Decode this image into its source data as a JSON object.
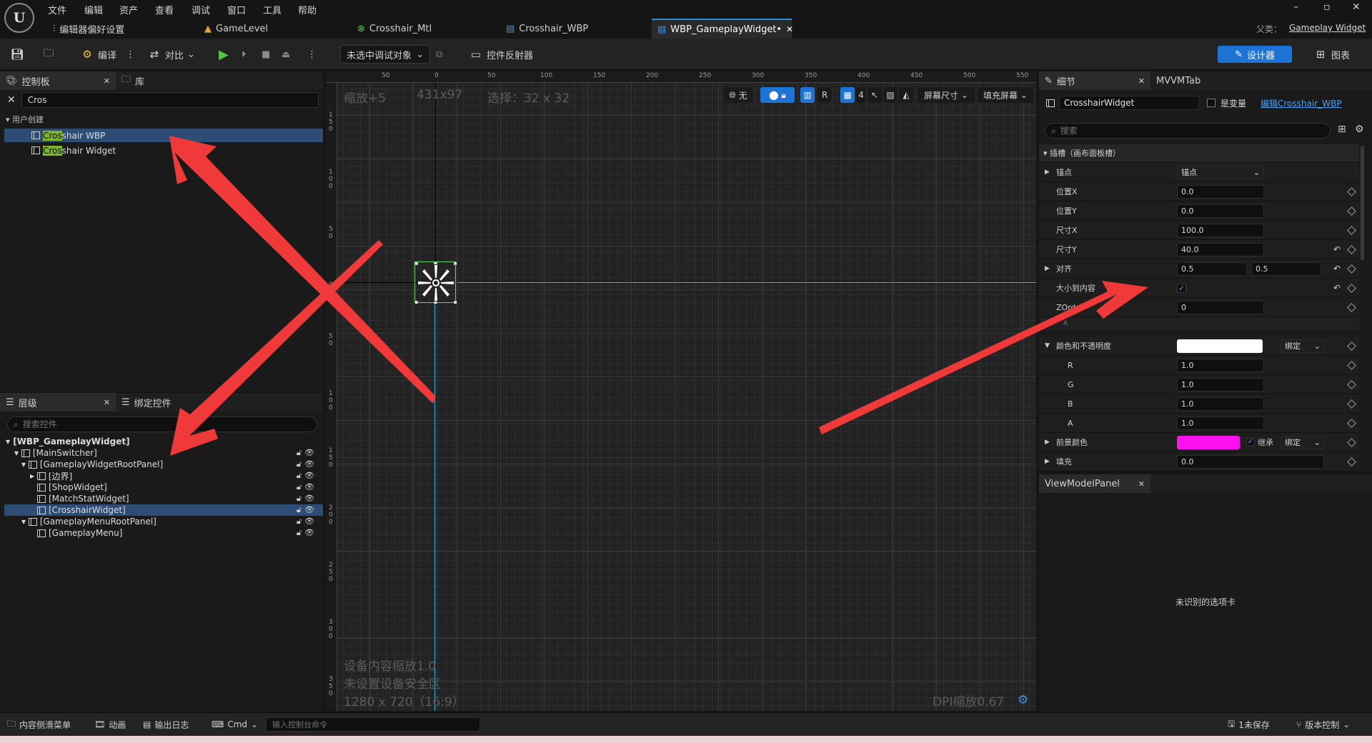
{
  "menu": [
    "文件",
    "编辑",
    "资产",
    "查看",
    "调试",
    "窗口",
    "工具",
    "帮助"
  ],
  "window_controls": [
    "–",
    "▫",
    "✕"
  ],
  "tabs": [
    {
      "label": "编辑器偏好设置",
      "icon": "sliders-icon"
    },
    {
      "label": "GameLevel",
      "icon": "level-icon"
    },
    {
      "label": "Crosshair_Mtl",
      "icon": "material-icon"
    },
    {
      "label": "Crosshair_WBP",
      "icon": "widget-blueprint-icon"
    },
    {
      "label": "WBP_GameplayWidget•",
      "icon": "widget-blueprint-icon",
      "active": true
    }
  ],
  "parent_class": {
    "label": "父类：",
    "value": "Gameplay Widget"
  },
  "toolbar": {
    "compile": "编译",
    "diff": "对比",
    "debug_target": "未选中调试对象",
    "widget_reflector": "控件反射器",
    "designer": "设计器",
    "graph": "图表"
  },
  "palette": {
    "tab": "控制板",
    "library_tab": "库",
    "search_value": "Cros",
    "category": "用户创建",
    "items": [
      {
        "match": "Cros",
        "rest": "shair WBP"
      },
      {
        "match": "Cros",
        "rest": "shair Widget"
      }
    ]
  },
  "hierarchy": {
    "tab": "层级",
    "bind_tab": "绑定控件",
    "search_placeholder": "搜索控件",
    "rows": [
      {
        "label": "[WBP_GameplayWidget]"
      },
      {
        "label": "[MainSwitcher]"
      },
      {
        "label": "[GameplayWidgetRootPanel]"
      },
      {
        "label": "[边界]"
      },
      {
        "label": "[ShopWidget]"
      },
      {
        "label": "[MatchStatWidget]"
      },
      {
        "label": "[CrosshairWidget]"
      },
      {
        "label": "[GameplayMenuRootPanel]"
      },
      {
        "label": "[GameplayMenu]"
      }
    ]
  },
  "viewport": {
    "zoom": "缩放+5",
    "size": "431x97",
    "selection": "选择：32 x 32",
    "scale_line1": "设备内容缩放1.0",
    "scale_line2": "未设置设备安全区",
    "scale_line3": "1280 x 720（16:9）",
    "dpi": "DPI缩放0.67",
    "btn_none": "无",
    "btn_r": "R",
    "btn_4": "4",
    "screen_size": "屏幕尺寸",
    "fill_screen": "填充屏幕",
    "ruler_top": [
      "50",
      "0",
      "50",
      "100",
      "150",
      "200",
      "250",
      "300",
      "350",
      "400",
      "450",
      "500",
      "550"
    ],
    "ruler_left": [
      "1\n5\n0",
      "1\n0\n0",
      "5\n0",
      "0",
      "5\n0",
      "1\n0\n0",
      "1\n5\n0",
      "2\n0\n0",
      "2\n5\n0",
      "3\n0\n0",
      "3\n5\n0"
    ]
  },
  "details": {
    "tab": "细节",
    "mvvm_tab": "MVVMTab",
    "name": "CrosshairWidget",
    "is_variable": "是变量",
    "edit_link": "编辑Crosshair_WBP",
    "search_placeholder": "搜索",
    "slot_section": "插槽（画布面板槽）",
    "anchor_label": "锚点",
    "anchor_value": "锚点",
    "pos_x_label": "位置X",
    "pos_x": "0.0",
    "pos_y_label": "位置Y",
    "pos_y": "0.0",
    "size_x_label": "尺寸X",
    "size_x": "100.0",
    "size_y_label": "尺寸Y",
    "size_y": "40.0",
    "align_label": "对齐",
    "align_x": "0.5",
    "align_y": "0.5",
    "size_to_content_label": "大小到内容",
    "zorder_label": "ZOrder",
    "zorder": "0",
    "collapsed_row": "A",
    "color_label": "颜色和不透明度",
    "bind": "绑定",
    "r_label": "R",
    "r": "1.0",
    "g_label": "G",
    "g": "1.0",
    "b_label": "B",
    "b": "1.0",
    "a_label": "A",
    "a": "1.0",
    "fg_label": "前景颜色",
    "inherit": "继承",
    "padding_label": "填充",
    "padding": "0.0",
    "color_swatch": "#ffffff",
    "fg_swatch": "#ff10ee"
  },
  "vm_panel": {
    "tab": "ViewModelPanel",
    "message": "未识别的选项卡"
  },
  "statusbar": {
    "content_drawer": "内容侧滑菜单",
    "animation": "动画",
    "output_log": "输出日志",
    "cmd": "Cmd",
    "console_placeholder": "输入控制台命令",
    "unsaved": "1未保存",
    "source_control": "版本控制"
  },
  "colors": {
    "accent": "#1d74d6",
    "selection": "#2d4d74",
    "match": "#7fb52e",
    "arrow": "#f03a3a"
  }
}
